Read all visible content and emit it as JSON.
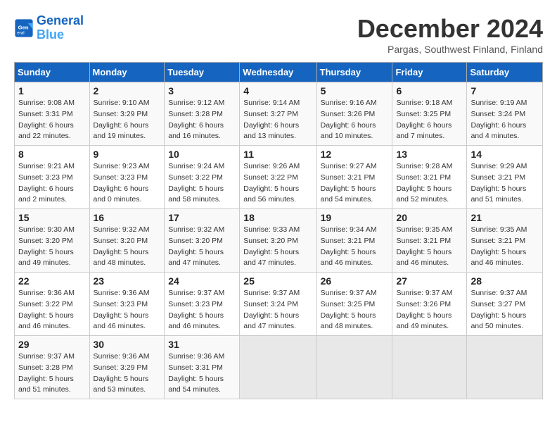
{
  "logo": {
    "line1": "General",
    "line2": "Blue"
  },
  "title": "December 2024",
  "subtitle": "Pargas, Southwest Finland, Finland",
  "days_header": [
    "Sunday",
    "Monday",
    "Tuesday",
    "Wednesday",
    "Thursday",
    "Friday",
    "Saturday"
  ],
  "weeks": [
    [
      {
        "day": "1",
        "sunrise": "Sunrise: 9:08 AM",
        "sunset": "Sunset: 3:31 PM",
        "daylight": "Daylight: 6 hours and 22 minutes."
      },
      {
        "day": "2",
        "sunrise": "Sunrise: 9:10 AM",
        "sunset": "Sunset: 3:29 PM",
        "daylight": "Daylight: 6 hours and 19 minutes."
      },
      {
        "day": "3",
        "sunrise": "Sunrise: 9:12 AM",
        "sunset": "Sunset: 3:28 PM",
        "daylight": "Daylight: 6 hours and 16 minutes."
      },
      {
        "day": "4",
        "sunrise": "Sunrise: 9:14 AM",
        "sunset": "Sunset: 3:27 PM",
        "daylight": "Daylight: 6 hours and 13 minutes."
      },
      {
        "day": "5",
        "sunrise": "Sunrise: 9:16 AM",
        "sunset": "Sunset: 3:26 PM",
        "daylight": "Daylight: 6 hours and 10 minutes."
      },
      {
        "day": "6",
        "sunrise": "Sunrise: 9:18 AM",
        "sunset": "Sunset: 3:25 PM",
        "daylight": "Daylight: 6 hours and 7 minutes."
      },
      {
        "day": "7",
        "sunrise": "Sunrise: 9:19 AM",
        "sunset": "Sunset: 3:24 PM",
        "daylight": "Daylight: 6 hours and 4 minutes."
      }
    ],
    [
      {
        "day": "8",
        "sunrise": "Sunrise: 9:21 AM",
        "sunset": "Sunset: 3:23 PM",
        "daylight": "Daylight: 6 hours and 2 minutes."
      },
      {
        "day": "9",
        "sunrise": "Sunrise: 9:23 AM",
        "sunset": "Sunset: 3:23 PM",
        "daylight": "Daylight: 6 hours and 0 minutes."
      },
      {
        "day": "10",
        "sunrise": "Sunrise: 9:24 AM",
        "sunset": "Sunset: 3:22 PM",
        "daylight": "Daylight: 5 hours and 58 minutes."
      },
      {
        "day": "11",
        "sunrise": "Sunrise: 9:26 AM",
        "sunset": "Sunset: 3:22 PM",
        "daylight": "Daylight: 5 hours and 56 minutes."
      },
      {
        "day": "12",
        "sunrise": "Sunrise: 9:27 AM",
        "sunset": "Sunset: 3:21 PM",
        "daylight": "Daylight: 5 hours and 54 minutes."
      },
      {
        "day": "13",
        "sunrise": "Sunrise: 9:28 AM",
        "sunset": "Sunset: 3:21 PM",
        "daylight": "Daylight: 5 hours and 52 minutes."
      },
      {
        "day": "14",
        "sunrise": "Sunrise: 9:29 AM",
        "sunset": "Sunset: 3:21 PM",
        "daylight": "Daylight: 5 hours and 51 minutes."
      }
    ],
    [
      {
        "day": "15",
        "sunrise": "Sunrise: 9:30 AM",
        "sunset": "Sunset: 3:20 PM",
        "daylight": "Daylight: 5 hours and 49 minutes."
      },
      {
        "day": "16",
        "sunrise": "Sunrise: 9:32 AM",
        "sunset": "Sunset: 3:20 PM",
        "daylight": "Daylight: 5 hours and 48 minutes."
      },
      {
        "day": "17",
        "sunrise": "Sunrise: 9:32 AM",
        "sunset": "Sunset: 3:20 PM",
        "daylight": "Daylight: 5 hours and 47 minutes."
      },
      {
        "day": "18",
        "sunrise": "Sunrise: 9:33 AM",
        "sunset": "Sunset: 3:20 PM",
        "daylight": "Daylight: 5 hours and 47 minutes."
      },
      {
        "day": "19",
        "sunrise": "Sunrise: 9:34 AM",
        "sunset": "Sunset: 3:21 PM",
        "daylight": "Daylight: 5 hours and 46 minutes."
      },
      {
        "day": "20",
        "sunrise": "Sunrise: 9:35 AM",
        "sunset": "Sunset: 3:21 PM",
        "daylight": "Daylight: 5 hours and 46 minutes."
      },
      {
        "day": "21",
        "sunrise": "Sunrise: 9:35 AM",
        "sunset": "Sunset: 3:21 PM",
        "daylight": "Daylight: 5 hours and 46 minutes."
      }
    ],
    [
      {
        "day": "22",
        "sunrise": "Sunrise: 9:36 AM",
        "sunset": "Sunset: 3:22 PM",
        "daylight": "Daylight: 5 hours and 46 minutes."
      },
      {
        "day": "23",
        "sunrise": "Sunrise: 9:36 AM",
        "sunset": "Sunset: 3:23 PM",
        "daylight": "Daylight: 5 hours and 46 minutes."
      },
      {
        "day": "24",
        "sunrise": "Sunrise: 9:37 AM",
        "sunset": "Sunset: 3:23 PM",
        "daylight": "Daylight: 5 hours and 46 minutes."
      },
      {
        "day": "25",
        "sunrise": "Sunrise: 9:37 AM",
        "sunset": "Sunset: 3:24 PM",
        "daylight": "Daylight: 5 hours and 47 minutes."
      },
      {
        "day": "26",
        "sunrise": "Sunrise: 9:37 AM",
        "sunset": "Sunset: 3:25 PM",
        "daylight": "Daylight: 5 hours and 48 minutes."
      },
      {
        "day": "27",
        "sunrise": "Sunrise: 9:37 AM",
        "sunset": "Sunset: 3:26 PM",
        "daylight": "Daylight: 5 hours and 49 minutes."
      },
      {
        "day": "28",
        "sunrise": "Sunrise: 9:37 AM",
        "sunset": "Sunset: 3:27 PM",
        "daylight": "Daylight: 5 hours and 50 minutes."
      }
    ],
    [
      {
        "day": "29",
        "sunrise": "Sunrise: 9:37 AM",
        "sunset": "Sunset: 3:28 PM",
        "daylight": "Daylight: 5 hours and 51 minutes."
      },
      {
        "day": "30",
        "sunrise": "Sunrise: 9:36 AM",
        "sunset": "Sunset: 3:29 PM",
        "daylight": "Daylight: 5 hours and 53 minutes."
      },
      {
        "day": "31",
        "sunrise": "Sunrise: 9:36 AM",
        "sunset": "Sunset: 3:31 PM",
        "daylight": "Daylight: 5 hours and 54 minutes."
      },
      null,
      null,
      null,
      null
    ]
  ]
}
